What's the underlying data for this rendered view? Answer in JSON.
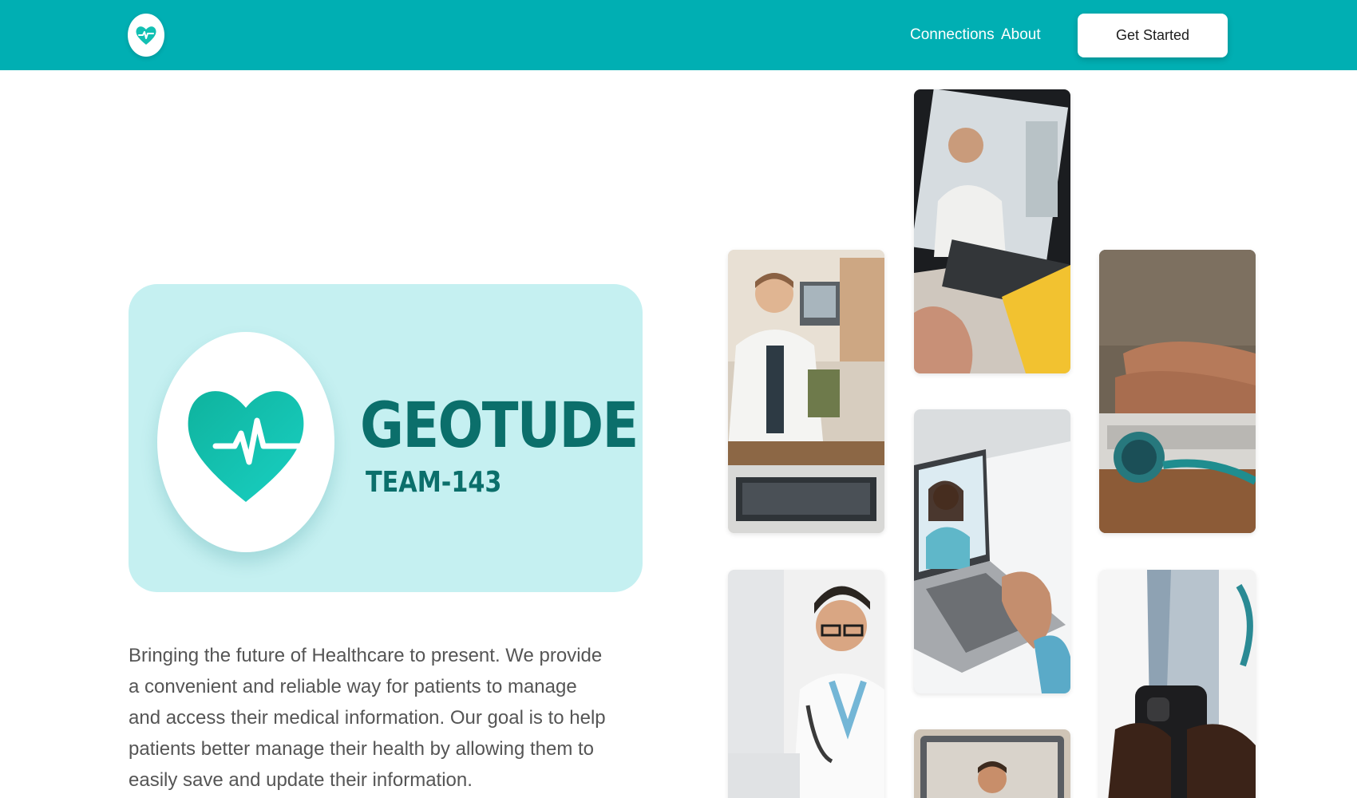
{
  "header": {
    "logo_icon": "heart-pulse-icon",
    "nav": {
      "connections": "Connections",
      "about": "About"
    },
    "cta_label": "Get Started"
  },
  "hero": {
    "brand": {
      "title": "GEOTUDE",
      "subtitle": "TEAM-143",
      "icon": "heart-pulse-icon"
    },
    "description": "Bringing the future of Healthcare to present. We provide a convenient and reliable way for patients to manage and access their medical information. Our goal is to help patients better manage their health by allowing them to easily save and update their information."
  },
  "gallery": {
    "photos": [
      "doctor-at-desk-photo",
      "doctor-video-call-tablet-photo",
      "hands-typing-stethoscope-photo",
      "doctor-glasses-stethoscope-photo",
      "laptop-video-consultation-photo",
      "doctor-holding-phone-photo",
      "laptop-doctor-screen-photo"
    ]
  },
  "colors": {
    "primary": "#00AFB3",
    "brand_card": "#C5F0F1",
    "brand_text": "#0B6F6B",
    "heart": "#12C0B3",
    "body_text": "#555555"
  }
}
